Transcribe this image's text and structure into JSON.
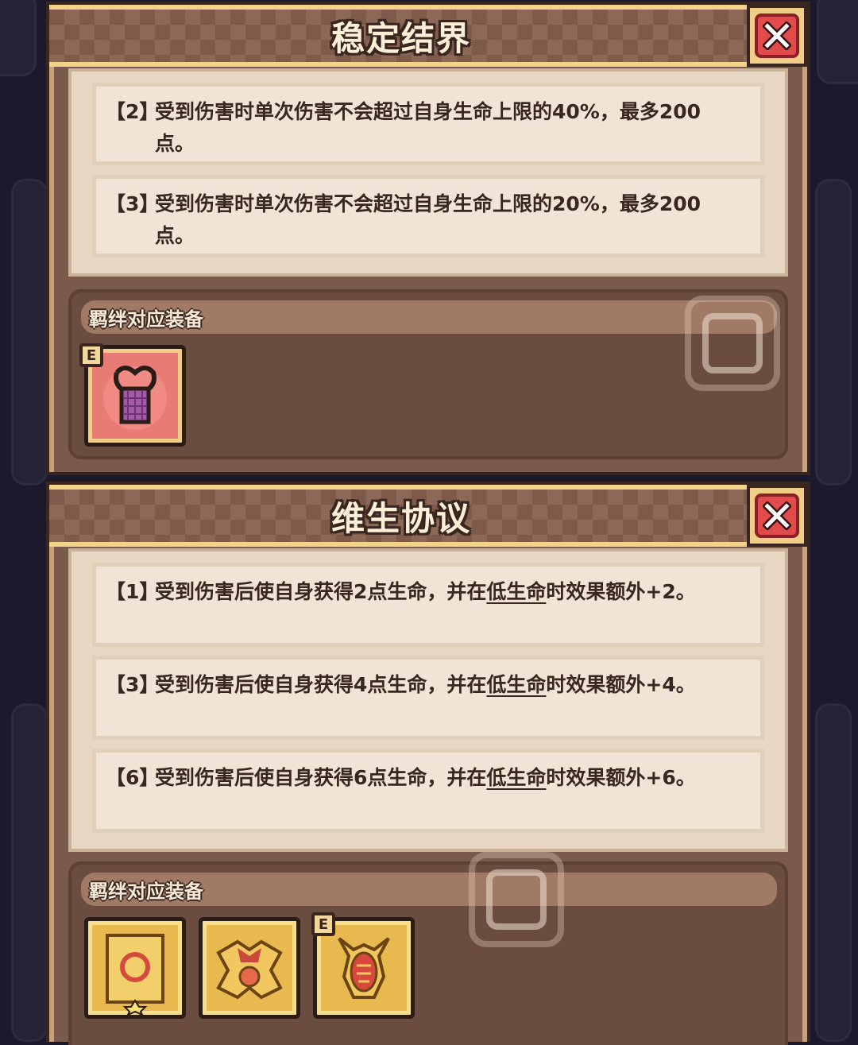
{
  "panels": [
    {
      "title": "稳定结界",
      "effects": [
        {
          "tier": "【2】",
          "text": "受到伤害时单次伤害不会超过自身生命上限的40%，最多200点。"
        },
        {
          "tier": "【3】",
          "text": "受到伤害时单次伤害不会超过自身生命上限的20%，最多200点。"
        }
      ],
      "equip_label": "羁绊对应装备",
      "equipment": [
        {
          "name": "heart-pendant-icon",
          "badge": "E"
        }
      ]
    },
    {
      "title": "维生协议",
      "effects": [
        {
          "tier": "【1】",
          "pre": "受到伤害后使自身获得2点生命，并在",
          "keyword": "低生命",
          "post": "时效果额外+2。"
        },
        {
          "tier": "【3】",
          "pre": "受到伤害后使自身获得4点生命，并在",
          "keyword": "低生命",
          "post": "时效果额外+4。"
        },
        {
          "tier": "【6】",
          "pre": "受到伤害后使自身获得6点生命，并在",
          "keyword": "低生命",
          "post": "时效果额外+6。"
        }
      ],
      "equip_label": "羁绊对应装备",
      "equipment": [
        {
          "name": "ring-scroll-icon",
          "badge": ""
        },
        {
          "name": "gold-armor-icon",
          "badge": ""
        },
        {
          "name": "beetle-helm-icon",
          "badge": "E"
        }
      ]
    }
  ],
  "colors": {
    "accent_gold": "#f0ce88",
    "close_red": "#e24b4b",
    "panel_brown": "#7a5a4b"
  }
}
